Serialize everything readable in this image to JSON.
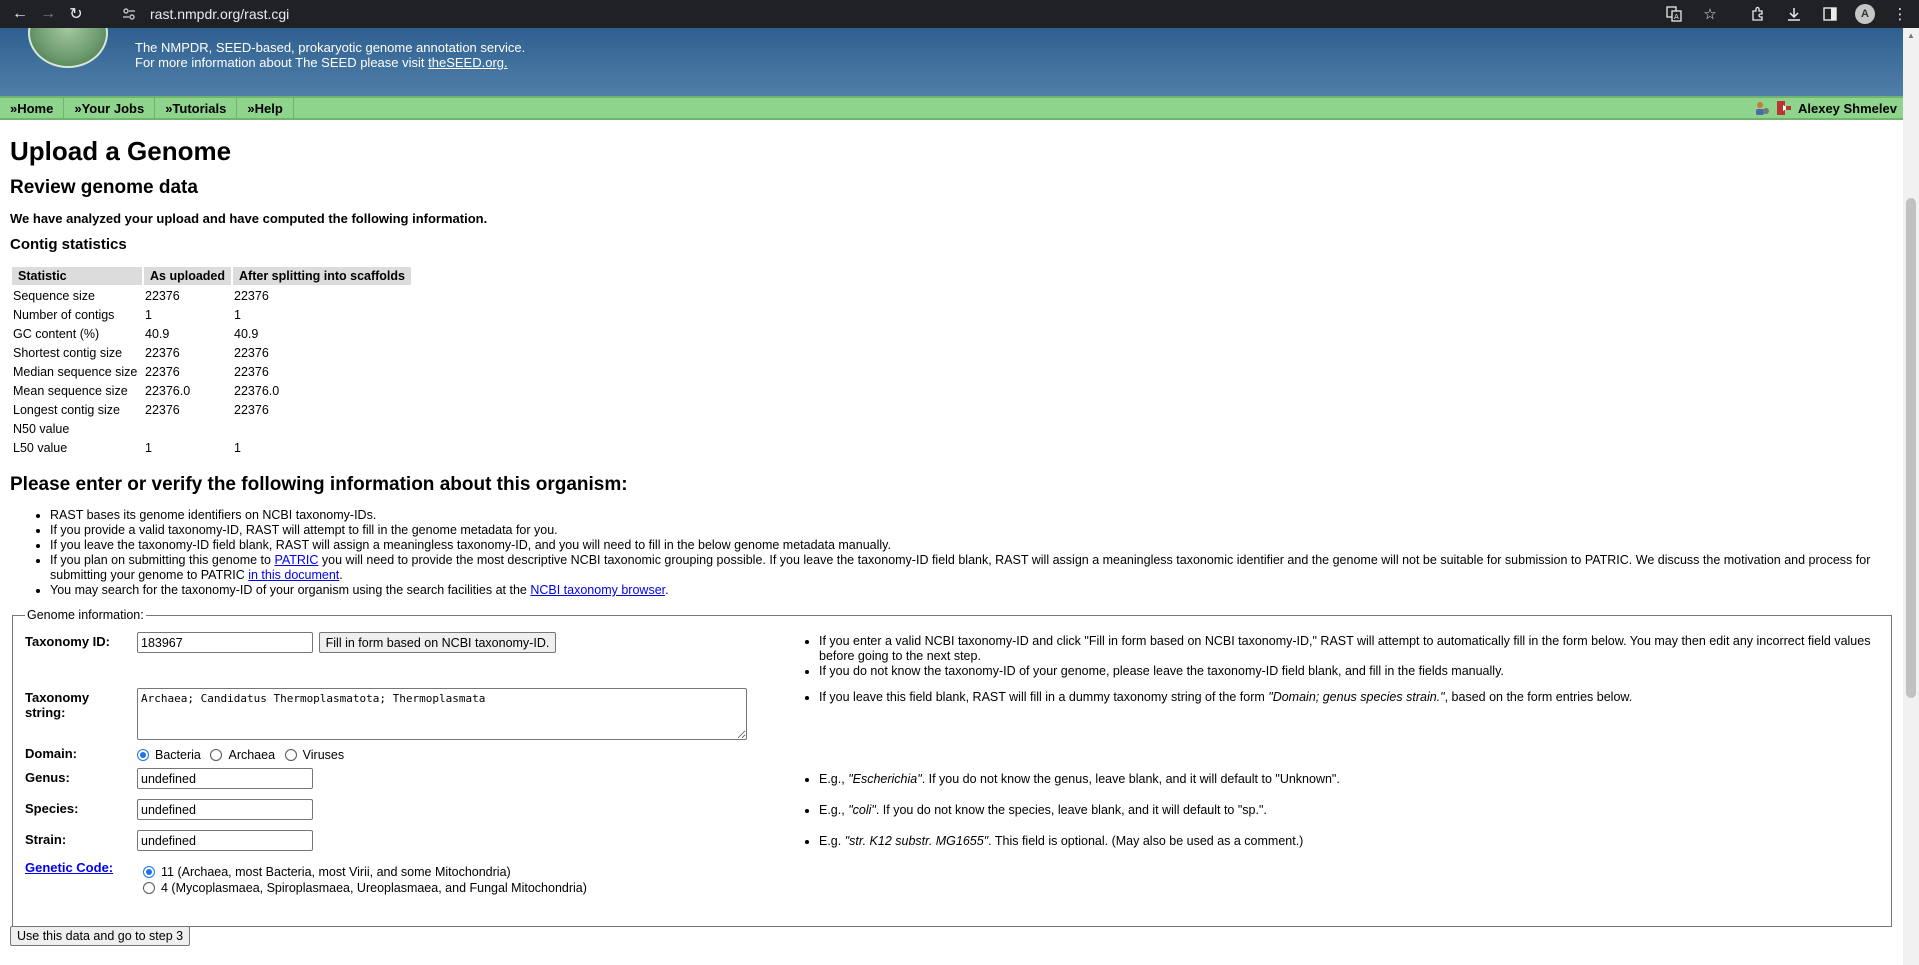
{
  "browser": {
    "url": "rast.nmpdr.org/rast.cgi",
    "avatar_letter": "A"
  },
  "banner": {
    "tagline1": "The NMPDR, SEED-based, prokaryotic genome annotation service.",
    "tagline2_prefix": "For more information about The SEED please visit ",
    "tagline2_link": "theSEED.org."
  },
  "nav": {
    "items": [
      "»Home",
      "»Your Jobs",
      "»Tutorials",
      "»Help"
    ],
    "user_name": "Alexey Shmelev"
  },
  "page": {
    "title": "Upload a Genome",
    "review_title": "Review genome data",
    "intro": "We have analyzed your upload and have computed the following information.",
    "contig_title": "Contig statistics"
  },
  "stats": {
    "headers": [
      "Statistic",
      "As uploaded",
      "After splitting into scaffolds"
    ],
    "rows": [
      [
        "Sequence size",
        "22376",
        "22376"
      ],
      [
        "Number of contigs",
        "1",
        "1"
      ],
      [
        "GC content (%)",
        "40.9",
        "40.9"
      ],
      [
        "Shortest contig size",
        "22376",
        "22376"
      ],
      [
        "Median sequence size",
        "22376",
        "22376"
      ],
      [
        "Mean sequence size",
        "22376.0",
        "22376.0"
      ],
      [
        "Longest contig size",
        "22376",
        "22376"
      ],
      [
        "N50 value",
        "",
        ""
      ],
      [
        "L50 value",
        "1",
        "1"
      ]
    ]
  },
  "verify": {
    "title": "Please enter or verify the following information about this organism:",
    "note1": "RAST bases its genome identifiers on NCBI taxonomy-IDs.",
    "note2": "If you provide a valid taxonomy-ID, RAST will attempt to fill in the genome metadata for you.",
    "note3": "If you leave the taxonomy-ID field blank, RAST will assign a meaningless taxonomy-ID, and you will need to fill in the below genome metadata manually.",
    "note4_a": "If you plan on submitting this genome to ",
    "note4_link1": "PATRIC",
    "note4_b": " you will need to provide the most descriptive NCBI taxonomic grouping possible. If you leave the taxonomy-ID field blank, RAST will assign a meaningless taxonomic identifier and the genome will not be suitable for submission to PATRIC. We discuss the motivation and process for submitting your genome to PATRIC ",
    "note4_link2": "in this document",
    "note4_c": ".",
    "note5_a": "You may search for the taxonomy-ID of your organism using the search facilities at the ",
    "note5_link": "NCBI taxonomy browser",
    "note5_b": "."
  },
  "form": {
    "legend": "Genome information:",
    "taxid_label": "Taxonomy ID:",
    "taxid_value": "183967",
    "fill_button": "Fill in form based on NCBI taxonomy-ID.",
    "taxid_help1": "If you enter a valid NCBI taxonomy-ID and click \"Fill in form based on NCBI taxonomy-ID,\" RAST will attempt to automatically fill in the form below. You may then edit any incorrect field values before going to the next step.",
    "taxid_help2": "If you do not know the taxonomy-ID of your genome, please leave the taxonomy-ID field blank, and fill in the fields manually.",
    "taxstring_label": "Taxonomy string:",
    "taxstring_value": "Archaea; Candidatus Thermoplasmatota; Thermoplasmata",
    "taxstring_help_a": "If you leave this field blank, RAST will fill in a dummy taxonomy string of the form ",
    "taxstring_help_em": "\"Domain; genus species strain.\"",
    "taxstring_help_b": ", based on the form entries below.",
    "domain_label": "Domain:",
    "domain_options": [
      "Bacteria",
      "Archaea",
      "Viruses"
    ],
    "domain_selected": "Bacteria",
    "genus_label": "Genus:",
    "genus_value": "undefined",
    "genus_help_a": "E.g., ",
    "genus_help_em": "\"Escherichia\"",
    "genus_help_b": ". If you do not know the genus, leave blank, and it will default to \"Unknown\".",
    "species_label": "Species:",
    "species_value": "undefined",
    "species_help_a": "E.g., ",
    "species_help_em": "\"coli\"",
    "species_help_b": ". If you do not know the species, leave blank, and it will default to \"sp.\".",
    "strain_label": "Strain:",
    "strain_value": "undefined",
    "strain_help_a": "E.g. ",
    "strain_help_em": "\"str. K12 substr. MG1655\"",
    "strain_help_b": ". This field is optional. (May also be used as a comment.)",
    "gc_label": "Genetic Code:",
    "gc_option1": "11 (Archaea, most Bacteria, most Virii, and some Mitochondria)",
    "gc_option2": "4 (Mycoplasmaea, Spiroplasmaea, Ureoplasmaea, and Fungal Mitochondria)",
    "gc_selected": "11",
    "submit_button": "Use this data and go to step 3"
  }
}
